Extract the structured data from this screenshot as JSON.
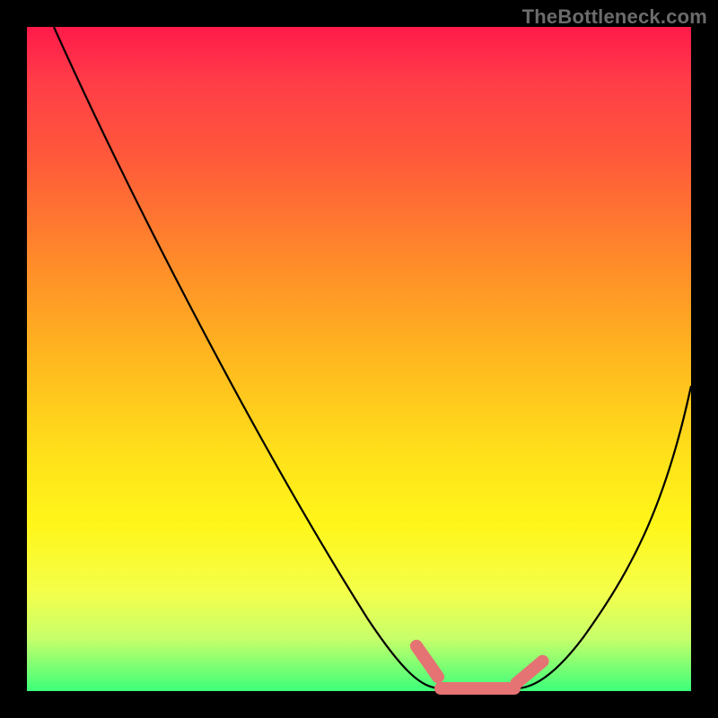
{
  "attribution": "TheBottleneck.com",
  "chart_data": {
    "type": "line",
    "title": "",
    "xlabel": "",
    "ylabel": "",
    "xlim": [
      0,
      100
    ],
    "ylim": [
      0,
      100
    ],
    "series": [
      {
        "name": "left-curve",
        "x": [
          4,
          10,
          20,
          30,
          40,
          48,
          54,
          58,
          61
        ],
        "y": [
          100,
          90,
          73,
          56,
          39,
          22,
          10,
          3,
          0
        ]
      },
      {
        "name": "valley-floor",
        "x": [
          61,
          64,
          68,
          72,
          75
        ],
        "y": [
          0,
          0,
          0,
          0,
          0
        ]
      },
      {
        "name": "right-curve",
        "x": [
          75,
          80,
          85,
          90,
          95,
          100
        ],
        "y": [
          0,
          6,
          14,
          24,
          36,
          48
        ]
      }
    ],
    "highlight_segments": [
      {
        "name": "salmon-left",
        "x_range": [
          57.5,
          63.5
        ],
        "angle_deg": 55
      },
      {
        "name": "salmon-floor",
        "x_range": [
          61,
          75
        ],
        "angle_deg": 0
      },
      {
        "name": "salmon-right",
        "x_range": [
          72,
          78
        ],
        "angle_deg": -40
      }
    ],
    "colors": {
      "curve": "#000000",
      "highlight": "#e57373",
      "gradient_top": "#ff1a4a",
      "gradient_mid": "#ffe21a",
      "gradient_bottom": "#3cff7a"
    }
  }
}
